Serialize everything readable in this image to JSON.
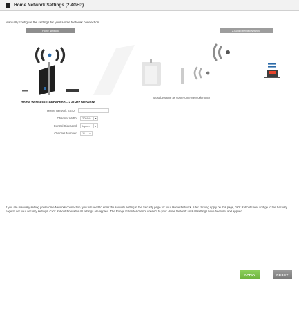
{
  "window": {
    "title": "Home Network Settings (2.4GHz)"
  },
  "intro_text": "Manually configure the settings for your Home Network connection.",
  "illustration": {
    "label_home_network": "Home Network",
    "label_extended_network": "2.4GHz Extended Network",
    "caption": "Must be same as your Home Network router"
  },
  "section": {
    "title": "Home Wireless Connection - 2.4GHz Network"
  },
  "form": {
    "ssid": {
      "label": "Home Network SSID:",
      "value": ""
    },
    "channel_width": {
      "label": "Channel Width:",
      "value": "20MHz"
    },
    "control_sideband": {
      "label": "Control Sideband:",
      "value": "Upper"
    },
    "channel_number": {
      "label": "Channel Number:",
      "value": "11"
    }
  },
  "note": "If you are manually setting your Home Network connection, you will need to enter the security setting in the Security page for your Home Network. After clicking Apply on this page, click Reboot Later and go to the Security page to set your security settings. Click Reboot Now after all settings are applied. The Range Extender cannot connect to your Home Network until all settings have been set and applied.",
  "buttons": {
    "apply": "APPLY",
    "reset": "RESET"
  },
  "colors": {
    "apply_green": "#7cc24b",
    "reset_gray": "#8a8a8a",
    "signal_blue": "#2b6aa8",
    "badge_red": "#e8432a"
  },
  "icons": {
    "router": "router-icon",
    "extender": "range-extender-icon",
    "laptop": "laptop-icon",
    "wifi_waves": "wifi-waves-icon"
  }
}
